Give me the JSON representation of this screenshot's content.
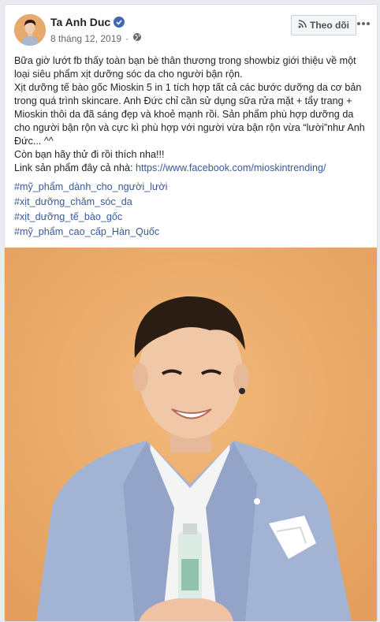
{
  "post": {
    "author_name": "Ta Anh Duc",
    "date": "8 tháng 12, 2019",
    "follow_label": "Theo dõi",
    "icons": {
      "verified": "verified-badge-icon",
      "privacy": "globe-icon",
      "follow": "rss-icon",
      "more": "more-options-icon"
    },
    "text_lines": [
      "Bữa giờ lướt fb thấy toàn bạn bè thân thương trong showbiz giới thiệu về một loại siêu phẩm xịt dưỡng sóc da cho người bận rộn.",
      "Xịt dưỡng tế bào gốc Mioskin 5 in 1 tích hợp tất cả các bước dưỡng da cơ bản trong quá trình skincare. Anh Đức chỉ cần sử dụng sữa rửa mặt + tẩy trang + Mioskin thôi da đã sáng đẹp và khoẻ mạnh rồi. Sản phẩm phù hợp dưỡng da cho người bận rộn và cực kì phù hợp với người vừa bận rộn vừa “lười”như Anh Đức... ^^",
      "Còn bạn hãy thử đi rồi thích nha!!!"
    ],
    "link_prefix": "Link sản phẩm đây cả nhà: ",
    "link_url": "https://www.facebook.com/mioskintrending/",
    "hashtags": [
      "#mỹ_phẩm_dành_cho_người_lười",
      "#xịt_dưỡng_chăm_sóc_da",
      "#xịt_dưỡng_tế_bào_gốc",
      "#mỹ_phẩm_cao_cấp_Hàn_Quốc"
    ]
  },
  "colors": {
    "link": "#385898",
    "photo_background": "#e9a768",
    "verified": "#4267b2"
  }
}
